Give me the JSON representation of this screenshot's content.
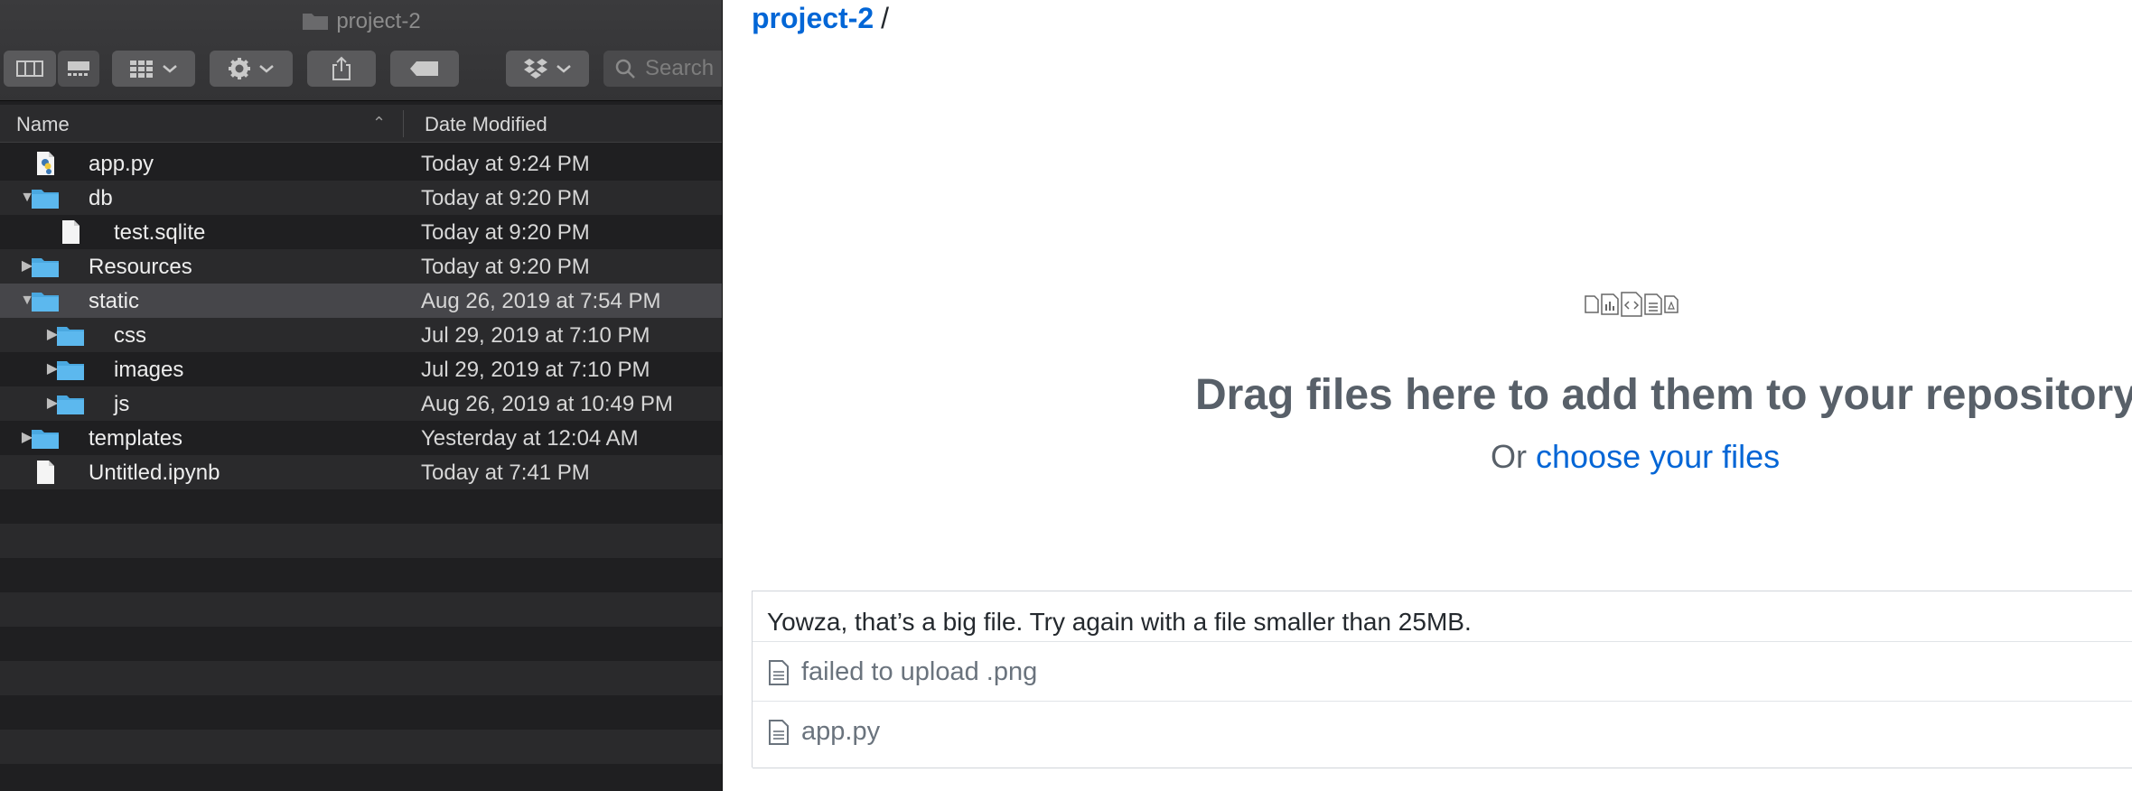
{
  "finder": {
    "window_title": "project-2",
    "search_placeholder": "Search",
    "columns": {
      "name": "Name",
      "date_modified": "Date Modified"
    },
    "rows": [
      {
        "name": "app.py",
        "date": "Today at 9:24 PM",
        "kind": "python-file",
        "level": 0,
        "disclosure": "none"
      },
      {
        "name": "db",
        "date": "Today at 9:20 PM",
        "kind": "folder",
        "level": 0,
        "disclosure": "expanded"
      },
      {
        "name": "test.sqlite",
        "date": "Today at 9:20 PM",
        "kind": "file",
        "level": 1,
        "disclosure": "none"
      },
      {
        "name": "Resources",
        "date": "Today at 9:20 PM",
        "kind": "folder",
        "level": 0,
        "disclosure": "collapsed"
      },
      {
        "name": "static",
        "date": "Aug 26, 2019 at 7:54 PM",
        "kind": "folder",
        "level": 0,
        "disclosure": "expanded",
        "selected": true
      },
      {
        "name": "css",
        "date": "Jul 29, 2019 at 7:10 PM",
        "kind": "folder",
        "level": 1,
        "disclosure": "collapsed"
      },
      {
        "name": "images",
        "date": "Jul 29, 2019 at 7:10 PM",
        "kind": "folder",
        "level": 1,
        "disclosure": "collapsed"
      },
      {
        "name": "js",
        "date": "Aug 26, 2019 at 10:49 PM",
        "kind": "folder",
        "level": 1,
        "disclosure": "collapsed"
      },
      {
        "name": "templates",
        "date": "Yesterday at 12:04 AM",
        "kind": "folder",
        "level": 0,
        "disclosure": "collapsed"
      },
      {
        "name": "Untitled.ipynb",
        "date": "Today at 7:41 PM",
        "kind": "file",
        "level": 0,
        "disclosure": "none"
      }
    ],
    "colors": {
      "folder": "#4aa8e0",
      "background": "#1f1f21",
      "stripe": "#2a2a2c",
      "selected": "#46464a"
    }
  },
  "upload": {
    "breadcrumb": {
      "repo": "project-2",
      "separator": "/"
    },
    "drag_title": "Drag files here to add them to your repository",
    "choose_prefix": "Or",
    "choose_link": "choose your files",
    "error_message": "Yowza, that’s a big file. Try again with a file smaller than 25MB.",
    "files": [
      {
        "label": "failed to upload .png"
      },
      {
        "label": "app.py"
      }
    ],
    "colors": {
      "link": "#0366d6",
      "muted": "#586069"
    }
  }
}
